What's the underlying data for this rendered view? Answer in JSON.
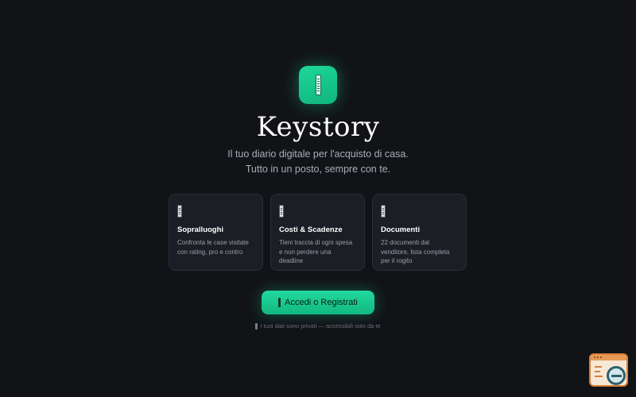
{
  "app": {
    "title": "Keystory",
    "tagline_line1": "Il tuo diario digitale per l'acquisto di casa.",
    "tagline_line2": "Tutto in un posto, sempre con te."
  },
  "features": [
    {
      "title": "Sopralluoghi",
      "description": "Confronta le case visitate con rating, pro e contro",
      "icon": "document-icon"
    },
    {
      "title": "Costi & Scadenze",
      "description": "Tieni traccia di ogni spesa e non perdere una deadline",
      "icon": "document-icon"
    },
    {
      "title": "Documenti",
      "description": "22 documenti dal venditore, lista completa per il rogito",
      "icon": "document-icon"
    }
  ],
  "cta": {
    "label": "Accedi o Registrati",
    "icon": "key-icon"
  },
  "privacy_note": "I tuoi dati sono privati — accessibili solo da te",
  "colors": {
    "background": "#121317",
    "accent": "#1ed79a",
    "card_background": "#1c1e25",
    "text_muted": "#a9adb8"
  }
}
